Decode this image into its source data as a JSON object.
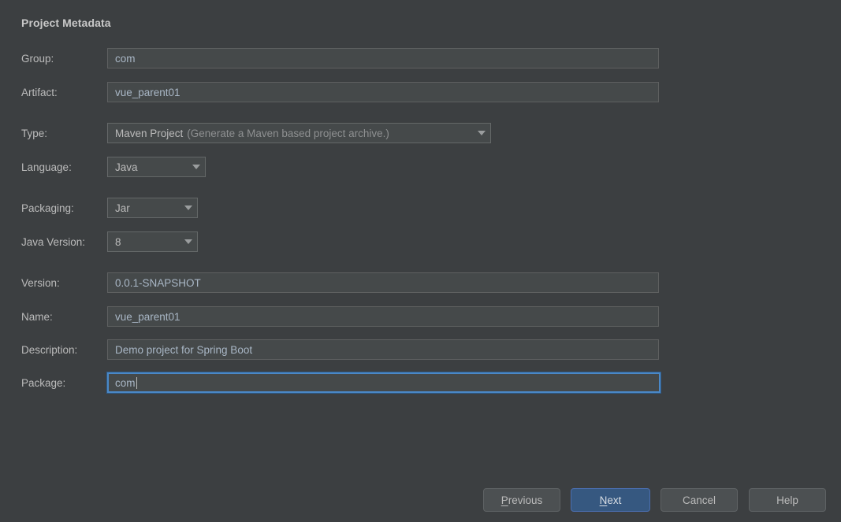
{
  "dialog": {
    "title": "Project Metadata",
    "background_color": "#3c3f41",
    "accent_color": "#365880",
    "focus_border_color": "#4a88c7"
  },
  "form": {
    "fields": [
      {
        "label": "Group:",
        "value": "com",
        "kind": "text",
        "focused": false
      },
      {
        "label": "Artifact:",
        "value": "vue_parent01",
        "kind": "text",
        "focused": false
      },
      {
        "label": "Type:",
        "value": "Maven Project",
        "hint": "(Generate a Maven based project archive.)",
        "kind": "combo",
        "focused": false
      },
      {
        "label": "Language:",
        "value": "Java",
        "kind": "combo",
        "focused": false
      },
      {
        "label": "Packaging:",
        "value": "Jar",
        "kind": "combo",
        "focused": false
      },
      {
        "label": "Java Version:",
        "value": "8",
        "kind": "combo",
        "focused": false
      },
      {
        "label": "Version:",
        "value": "0.0.1-SNAPSHOT",
        "kind": "text",
        "focused": false
      },
      {
        "label": "Name:",
        "value": "vue_parent01",
        "kind": "text",
        "focused": false
      },
      {
        "label": "Description:",
        "value": "Demo project for Spring Boot",
        "kind": "text",
        "focused": false
      },
      {
        "label": "Package:",
        "value": "com",
        "kind": "text",
        "focused": true
      }
    ]
  },
  "buttons": {
    "previous": {
      "label": "Previous",
      "mnemonic": "P",
      "rest": "revious",
      "primary": false
    },
    "next": {
      "label": "Next",
      "mnemonic": "N",
      "rest": "ext",
      "primary": true
    },
    "cancel": {
      "label": "Cancel",
      "primary": false
    },
    "help": {
      "label": "Help",
      "primary": false
    }
  }
}
